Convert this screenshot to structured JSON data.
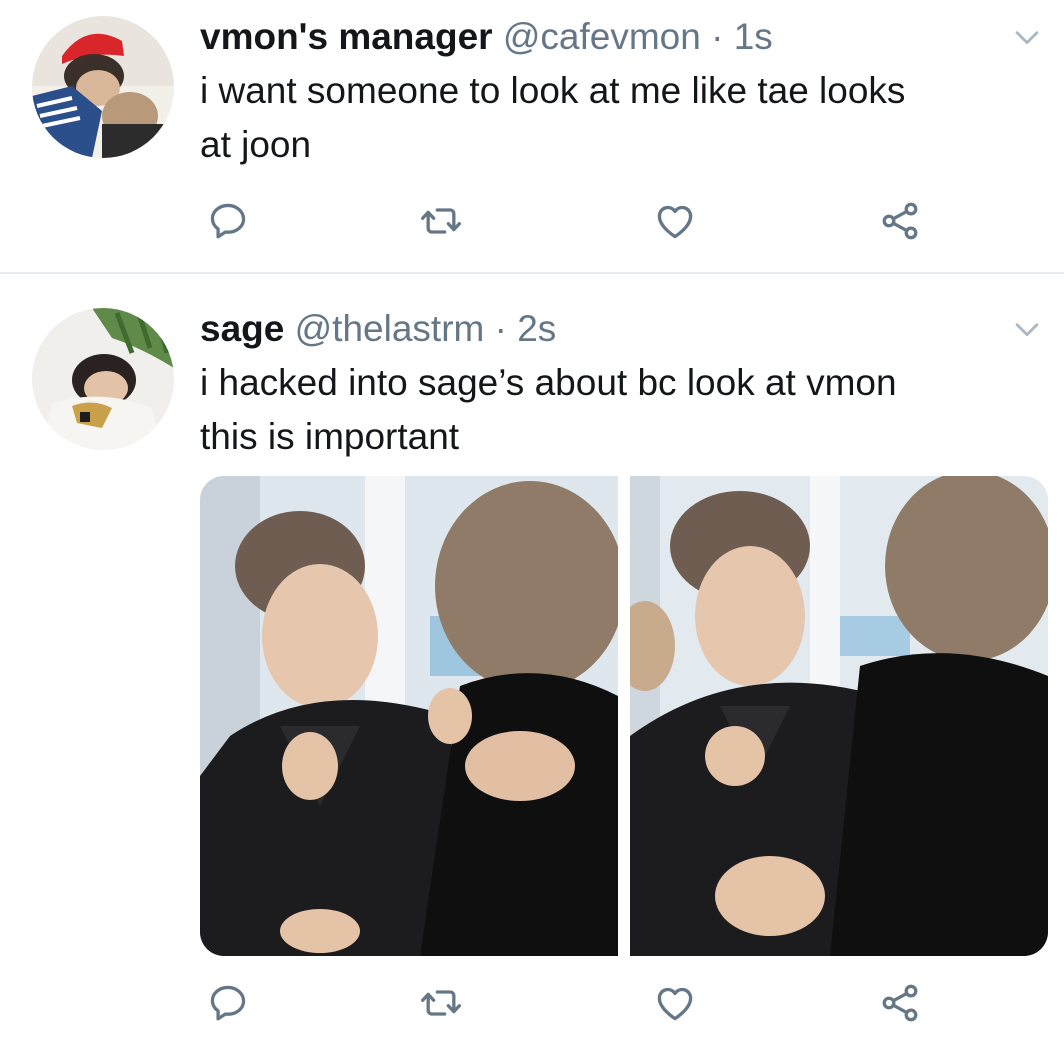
{
  "colors": {
    "text_primary": "#14171a",
    "text_secondary": "#657786",
    "icon": "#657786",
    "separator": "#e6ecf0"
  },
  "tweets": [
    {
      "display_name": "vmon's manager",
      "handle": "@cafevmon",
      "separator_dot": "·",
      "time": "1s",
      "text_lines": [
        "i want someone to look at me like tae looks",
        "at joon"
      ],
      "icons": {
        "reply": "reply-icon",
        "retweet": "retweet-icon",
        "like": "heart-icon",
        "share": "share-icon",
        "menu": "chevron-down-icon"
      }
    },
    {
      "display_name": "sage",
      "handle": "@thelastrm",
      "separator_dot": "·",
      "time": "2s",
      "text_lines": [
        "i hacked into sage’s about bc look at vmon",
        "this is important"
      ],
      "media_count": 2,
      "icons": {
        "reply": "reply-icon",
        "retweet": "retweet-icon",
        "like": "heart-icon",
        "share": "share-icon",
        "menu": "chevron-down-icon"
      }
    }
  ]
}
